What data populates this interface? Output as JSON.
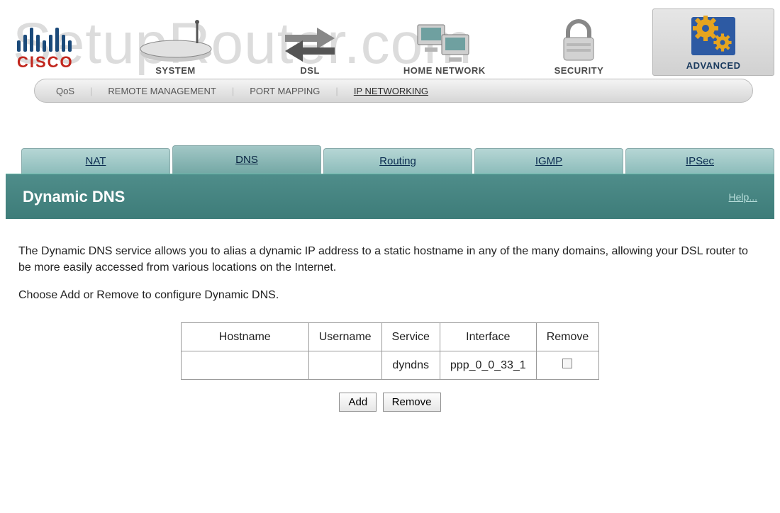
{
  "watermark": "SetupRouter.com",
  "logo_text": "CISCO",
  "categories": [
    {
      "id": "system",
      "label": "SYSTEM",
      "icon": "router-icon"
    },
    {
      "id": "dsl",
      "label": "DSL",
      "icon": "arrows-icon"
    },
    {
      "id": "home-network",
      "label": "HOME NETWORK",
      "icon": "computers-icon"
    },
    {
      "id": "security",
      "label": "SECURITY",
      "icon": "padlock-icon"
    },
    {
      "id": "advanced",
      "label": "ADVANCED",
      "icon": "gears-icon",
      "active": true
    }
  ],
  "subnav": [
    {
      "id": "qos",
      "label": "QoS"
    },
    {
      "id": "remote-management",
      "label": "REMOTE MANAGEMENT"
    },
    {
      "id": "port-mapping",
      "label": "PORT MAPPING"
    },
    {
      "id": "ip-networking",
      "label": "IP NETWORKING",
      "active": true
    }
  ],
  "tabs": [
    {
      "id": "nat",
      "label": "NAT"
    },
    {
      "id": "dns",
      "label": "DNS",
      "active": true
    },
    {
      "id": "routing",
      "label": "Routing"
    },
    {
      "id": "igmp",
      "label": "IGMP"
    },
    {
      "id": "ipsec",
      "label": "IPSec"
    }
  ],
  "header": {
    "title": "Dynamic DNS",
    "help_label": "Help..."
  },
  "body": {
    "para1": "The Dynamic DNS service allows you to alias a dynamic IP address to a static hostname in any of the many domains, allowing your DSL router to be more easily accessed from various locations on the Internet.",
    "para2": "Choose Add or Remove to configure Dynamic DNS."
  },
  "table": {
    "headers": [
      "Hostname",
      "Username",
      "Service",
      "Interface",
      "Remove"
    ],
    "rows": [
      {
        "hostname": "",
        "username": "",
        "service": "dyndns",
        "interface": "ppp_0_0_33_1",
        "remove_checked": false
      }
    ]
  },
  "buttons": {
    "add": "Add",
    "remove": "Remove"
  }
}
